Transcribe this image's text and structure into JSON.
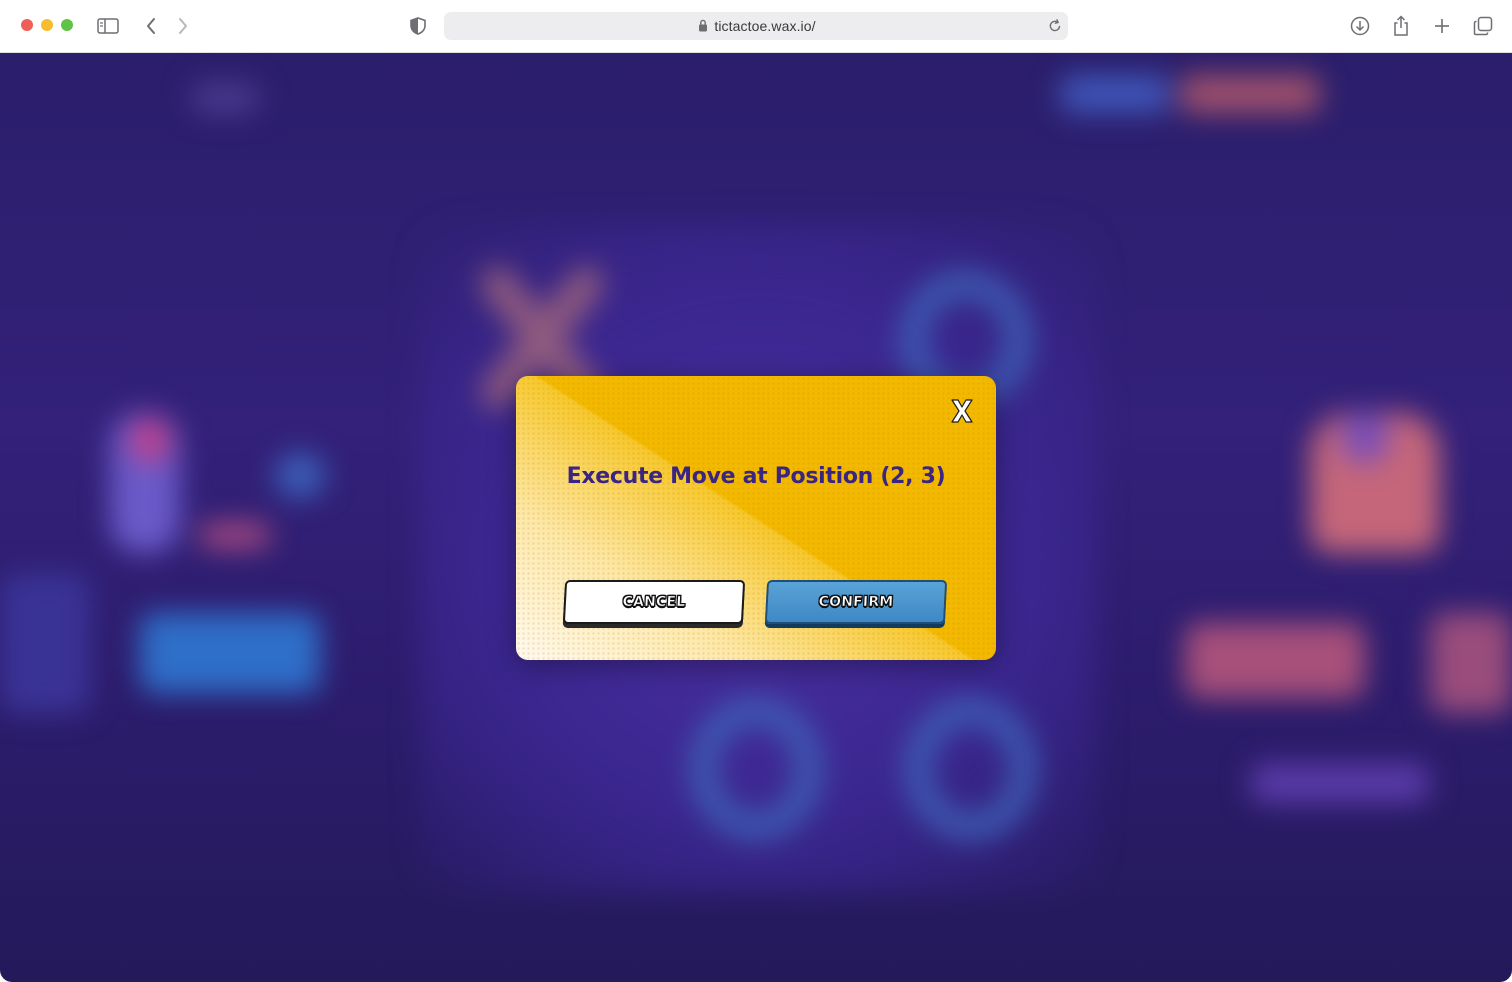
{
  "browser": {
    "url": "tictactoe.wax.io/"
  },
  "modal": {
    "title": "Execute Move at Position (2, 3)",
    "close_label": "X",
    "cancel_label": "CANCEL",
    "confirm_label": "CONFIRM"
  },
  "colors": {
    "background": "#2b1e6b",
    "modal_yellow": "#f3b900",
    "title_purple": "#3a2582",
    "confirm_blue": "#3e88c4"
  }
}
